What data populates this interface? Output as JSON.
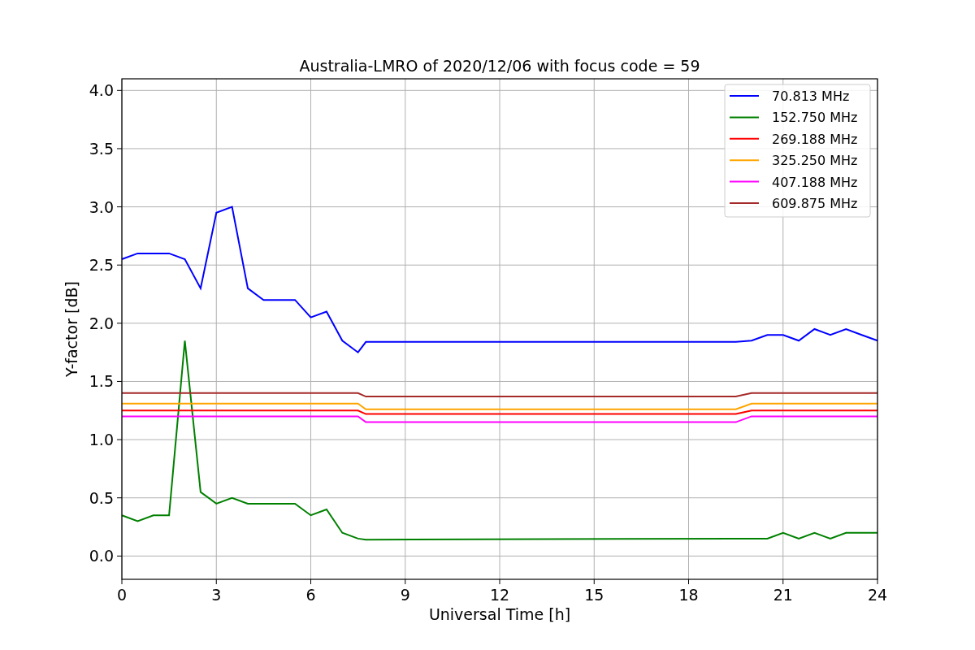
{
  "chart_data": {
    "type": "line",
    "title": "Australia-LMRO of 2020/12/06 with focus code = 59",
    "xlabel": "Universal Time [h]",
    "ylabel": "Y-factor [dB]",
    "x": [
      0,
      0.5,
      1,
      1.5,
      2,
      2.5,
      3,
      3.5,
      4,
      4.5,
      5,
      5.5,
      6,
      6.5,
      7,
      7.5,
      7.75,
      19.5,
      20,
      20.5,
      21,
      21.5,
      22,
      22.5,
      23,
      23.5,
      24
    ],
    "series": [
      {
        "name": "70.813 MHz",
        "color": "#0000ff",
        "values": [
          2.55,
          2.6,
          2.6,
          2.6,
          2.55,
          2.3,
          2.95,
          3.0,
          2.3,
          2.2,
          2.2,
          2.2,
          2.05,
          2.1,
          1.85,
          1.75,
          1.84,
          1.84,
          1.85,
          1.9,
          1.9,
          1.85,
          1.95,
          1.9,
          1.95,
          1.9,
          1.85
        ]
      },
      {
        "name": "152.750 MHz",
        "color": "#008000",
        "values": [
          0.35,
          0.3,
          0.35,
          0.35,
          1.85,
          0.55,
          0.45,
          0.5,
          0.45,
          0.45,
          0.45,
          0.45,
          0.35,
          0.4,
          0.2,
          0.15,
          0.14,
          0.15,
          0.15,
          0.15,
          0.2,
          0.15,
          0.2,
          0.15,
          0.2,
          0.2,
          0.2
        ]
      },
      {
        "name": "269.188 MHz",
        "color": "#ff0000",
        "values": [
          1.25,
          1.25,
          1.25,
          1.25,
          1.25,
          1.25,
          1.25,
          1.25,
          1.25,
          1.25,
          1.25,
          1.25,
          1.25,
          1.25,
          1.25,
          1.25,
          1.22,
          1.22,
          1.25,
          1.25,
          1.25,
          1.25,
          1.25,
          1.25,
          1.25,
          1.25,
          1.25
        ]
      },
      {
        "name": "325.250 MHz",
        "color": "#ffa500",
        "values": [
          1.31,
          1.31,
          1.31,
          1.31,
          1.31,
          1.31,
          1.31,
          1.31,
          1.31,
          1.31,
          1.31,
          1.31,
          1.31,
          1.31,
          1.31,
          1.31,
          1.26,
          1.26,
          1.31,
          1.31,
          1.31,
          1.31,
          1.31,
          1.31,
          1.31,
          1.31,
          1.31
        ]
      },
      {
        "name": "407.188 MHz",
        "color": "#ff00ff",
        "values": [
          1.2,
          1.2,
          1.2,
          1.2,
          1.2,
          1.2,
          1.2,
          1.2,
          1.2,
          1.2,
          1.2,
          1.2,
          1.2,
          1.2,
          1.2,
          1.2,
          1.15,
          1.15,
          1.2,
          1.2,
          1.2,
          1.2,
          1.2,
          1.2,
          1.2,
          1.2,
          1.2
        ]
      },
      {
        "name": "609.875 MHz",
        "color": "#a52a2a",
        "values": [
          1.4,
          1.4,
          1.4,
          1.4,
          1.4,
          1.4,
          1.4,
          1.4,
          1.4,
          1.4,
          1.4,
          1.4,
          1.4,
          1.4,
          1.4,
          1.4,
          1.37,
          1.37,
          1.4,
          1.4,
          1.4,
          1.4,
          1.4,
          1.4,
          1.4,
          1.4,
          1.4
        ]
      }
    ],
    "grid": true,
    "legend": true,
    "xlim": [
      0,
      24
    ],
    "ylim": [
      -0.2,
      4.1
    ],
    "xticks": [
      0,
      3,
      6,
      9,
      12,
      15,
      18,
      21,
      24
    ],
    "yticks": [
      {
        "value": 0,
        "label": "0.0"
      },
      {
        "value": 0.5,
        "label": "0.5"
      },
      {
        "value": 1,
        "label": "1.0"
      },
      {
        "value": 1.5,
        "label": "1.5"
      },
      {
        "value": 2,
        "label": "2.0"
      },
      {
        "value": 2.5,
        "label": "2.5"
      },
      {
        "value": 3,
        "label": "3.0"
      },
      {
        "value": 3.5,
        "label": "3.5"
      },
      {
        "value": 4,
        "label": "4.0"
      }
    ]
  }
}
